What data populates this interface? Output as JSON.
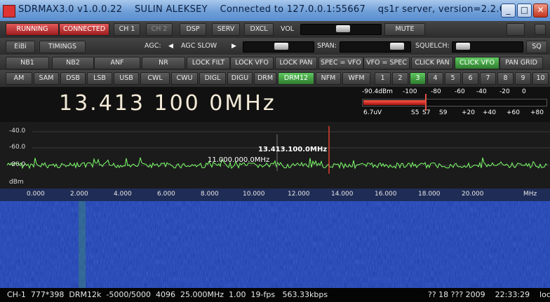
{
  "window": {
    "title": "SDRMAX3.0 v1.0.0.22    SULIN ALEKSEY    Connected to 127.0.0.1:55667    qs1r server, version=2.2.0.5",
    "minimize": "_",
    "maximize": "□",
    "close": "✕"
  },
  "toolbar1": {
    "running": "RUNNING",
    "connected": "CONNECTED",
    "ch1": "CH 1",
    "ch2": "CH 2",
    "dsp": "DSP",
    "serv": "SERV",
    "dxcl": "DXCL",
    "vol": "VOL",
    "mute": "MUTE",
    "vol_level": 0.53
  },
  "toolbar2": {
    "eibi": "EiBi",
    "timings": "TIMINGS",
    "agc": "AGC:",
    "agc_mode": "AGC SLOW",
    "span": "SPAN:",
    "squelch": "SQUELCH:",
    "sq": "SQ",
    "agc_level": 0.55,
    "span_level": 0.9,
    "squelch_level": 0.05
  },
  "toolbar3": [
    "NB1",
    "NB2",
    "ANF",
    "NR",
    "LOCK FILT",
    "LOCK VFO",
    "LOCK PAN",
    "SPEC = VFO",
    "VFO = SPEC",
    "CLICK PAN",
    "CLICK VFO",
    "PAN GRID"
  ],
  "toolbar3_active": "CLICK VFO",
  "modes": [
    "AM",
    "SAM",
    "DSB",
    "LSB",
    "USB",
    "CWL",
    "CWU",
    "DIGL",
    "DIGU",
    "DRM",
    "DRM12",
    "NFM",
    "WFM"
  ],
  "mode_active": "DRM12",
  "bands": [
    "1",
    "2",
    "3",
    "4",
    "5",
    "6",
    "7",
    "8",
    "9",
    "10"
  ],
  "band_active": "3",
  "frequency": "13.413 100 0MHz",
  "meter": {
    "top_labels": [
      "-90.4dBm",
      "-100",
      "-80",
      "-60",
      "-40",
      "-20",
      "0"
    ],
    "bottom_labels": [
      "6.7uV",
      "S5",
      "S7",
      "S9",
      "+20",
      "+40",
      "+60",
      "+80"
    ],
    "level": 0.34
  },
  "spectrum": {
    "db_labels": [
      "-40.0",
      "-60.0",
      "-80.0",
      "dBm"
    ],
    "marker1": "13.413.100.0MHz",
    "marker2": "11.000.000.0MHz"
  },
  "axis_labels": [
    "0.000",
    "2.000",
    "4.000",
    "6.000",
    "8.000",
    "10.000",
    "12.000",
    "14.000",
    "16.000",
    "18.000",
    "20.000",
    "MHz"
  ],
  "colors": {
    "running": "#c42a2a",
    "active_green": "#3a9a3a",
    "trace": "#7cff6a",
    "waterfall": "#1e3aa5"
  },
  "status": {
    "left": "CH-1  777*398  DRM12k  -5000/5000  4096  25.000MHz  1.00  19-fps   563.33kbps",
    "right": "?? 18 ??? 2009    22:33:29    loc"
  }
}
